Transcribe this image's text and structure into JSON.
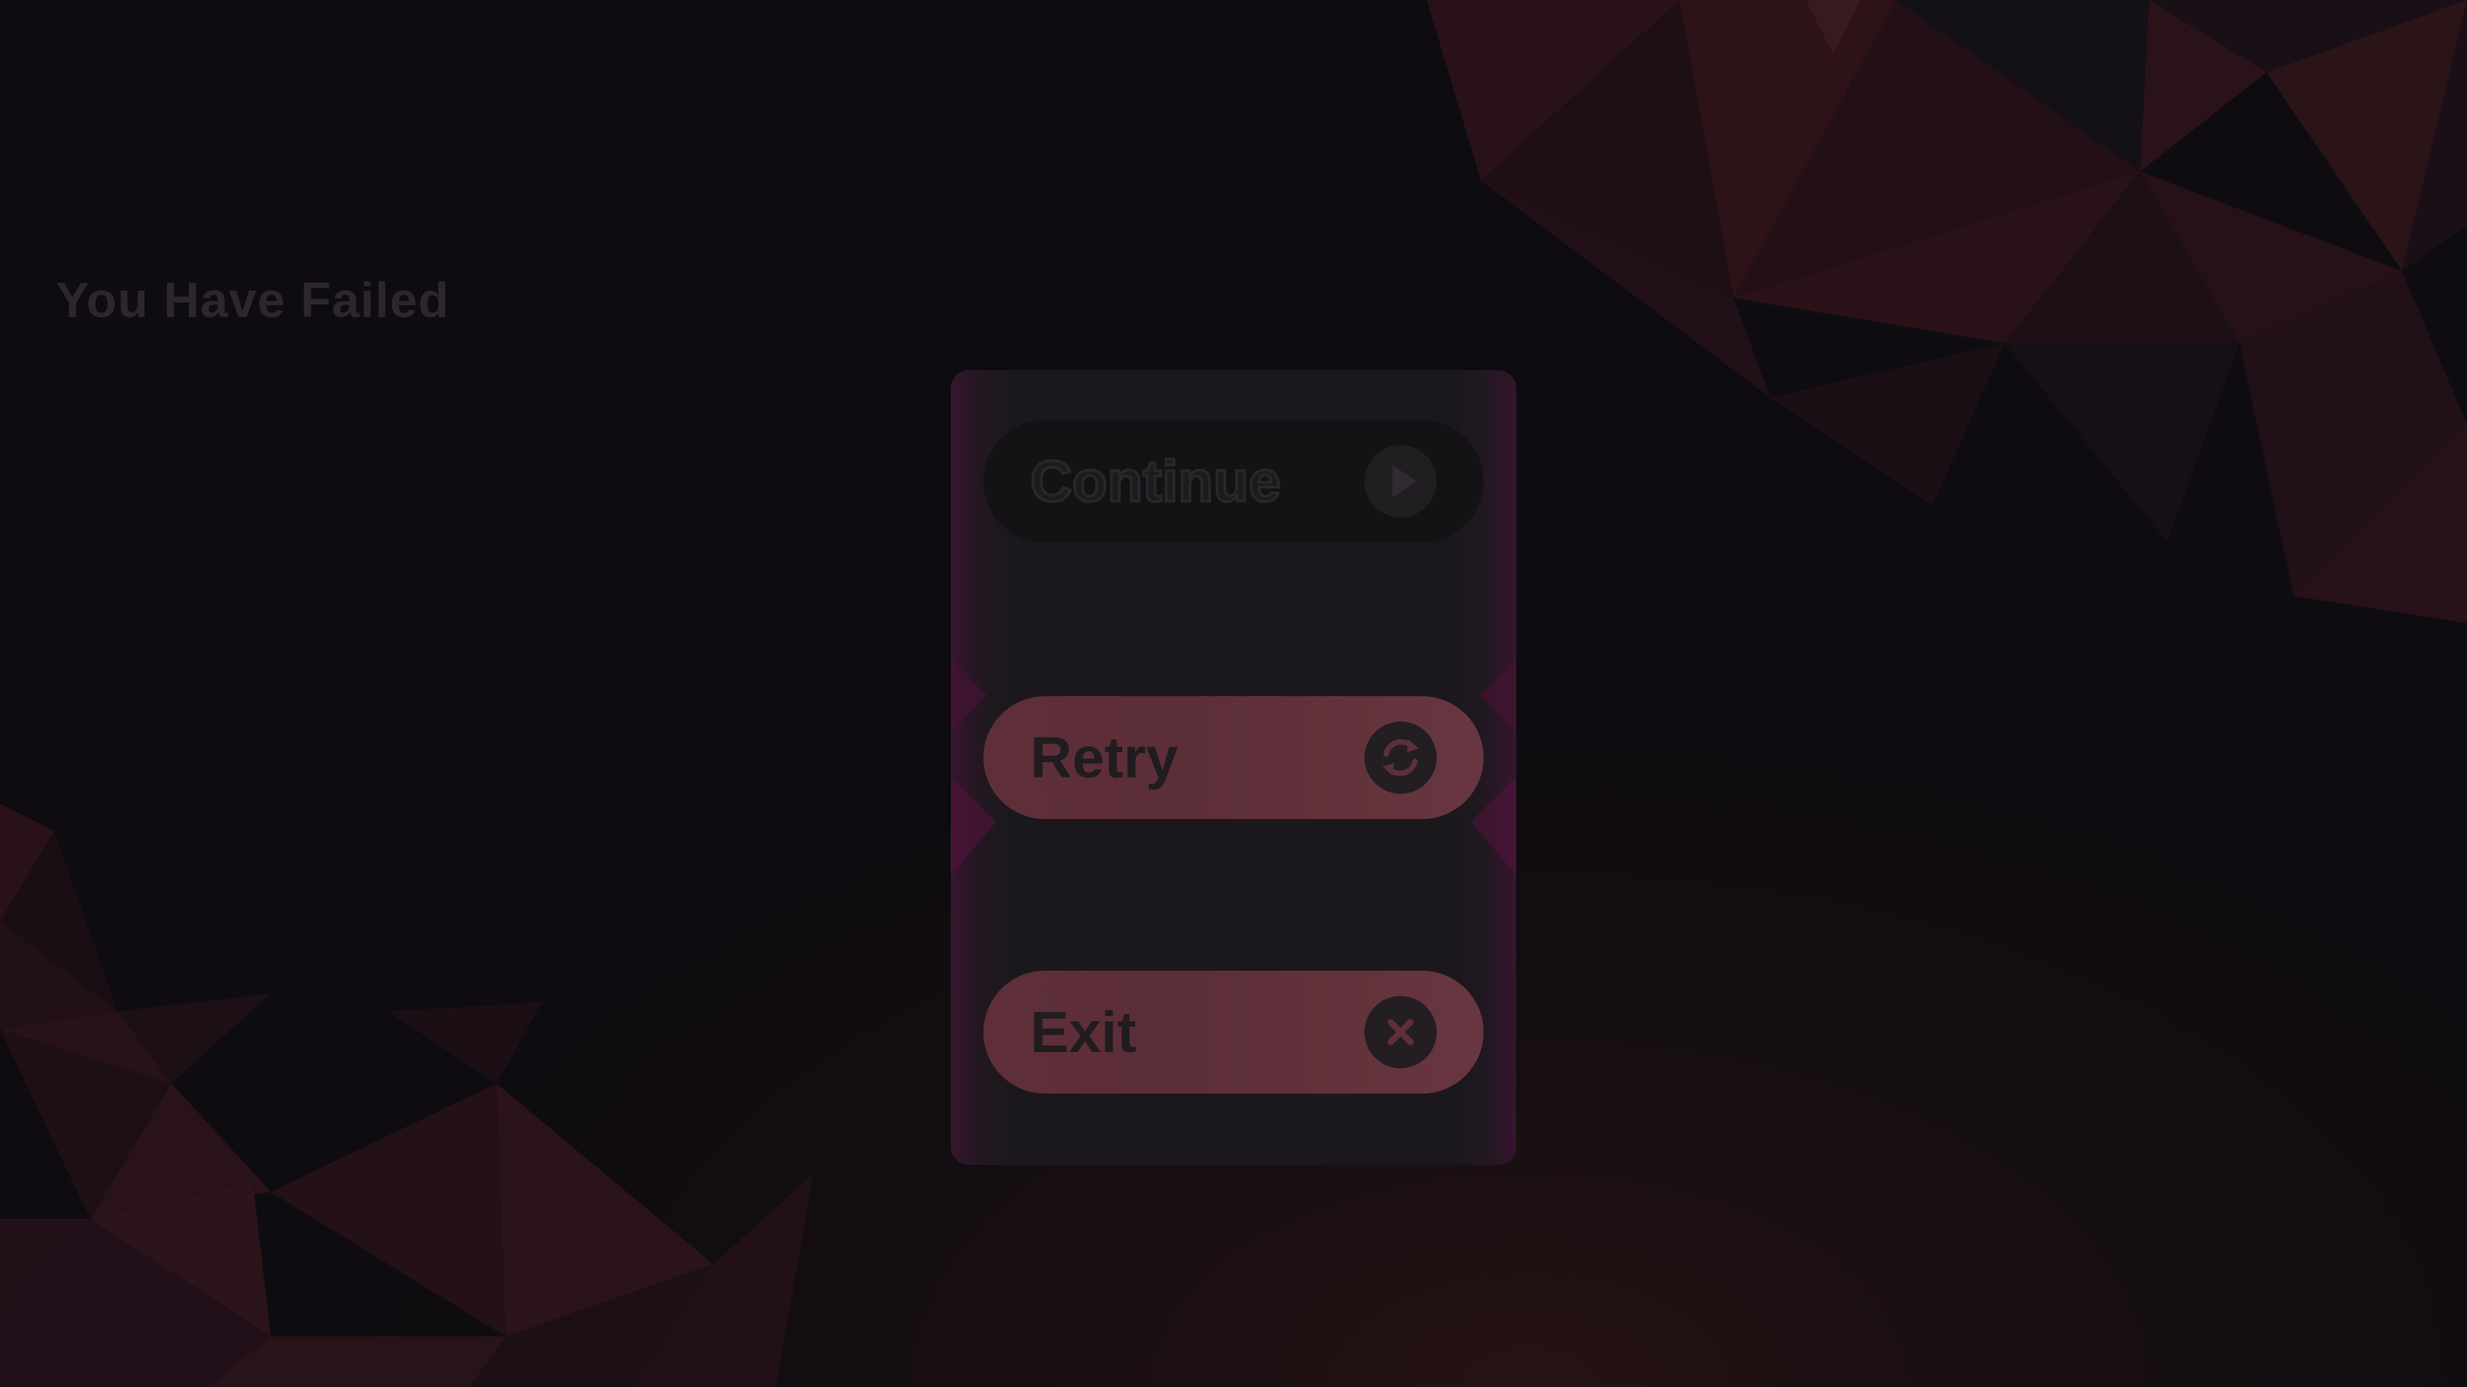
{
  "screen": {
    "title": "You Have Failed"
  },
  "menu": {
    "continue": {
      "label": "Continue",
      "icon": "play-icon",
      "state": "disabled"
    },
    "retry": {
      "label": "Retry",
      "icon": "refresh-icon"
    },
    "exit": {
      "label": "Exit",
      "icon": "close-icon"
    }
  },
  "colors": {
    "background": "#0e0c10",
    "accent": "#5e2f38",
    "panel": "#1b181d",
    "title_text": "#2b272d"
  }
}
